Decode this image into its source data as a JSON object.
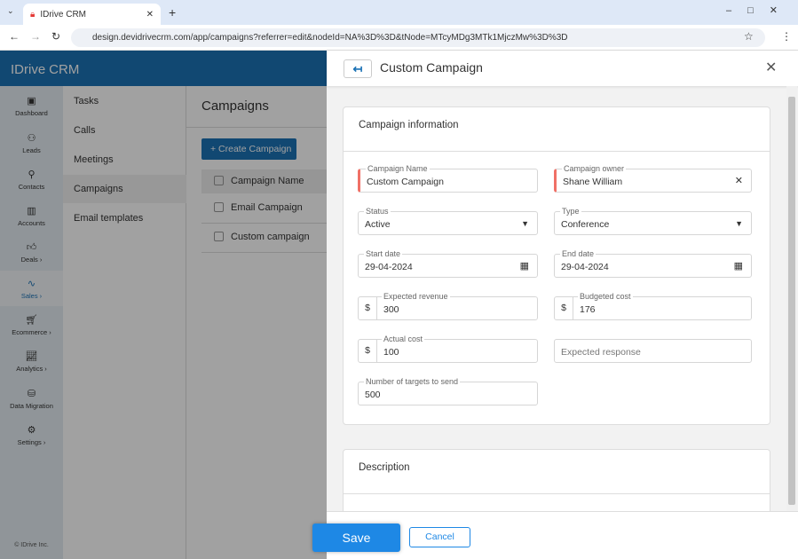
{
  "browser": {
    "tab_title": "IDrive CRM",
    "url": "design.devidrivecrm.com/app/campaigns?referrer=edit&nodeId=NA%3D%3D&tNode=MTcyMDg3MTk1MjczMw%3D%3D"
  },
  "app": {
    "logo": "IDrive",
    "logo_suffix": "CRM",
    "copyright": "© IDrive Inc."
  },
  "rail": [
    {
      "label": "Dashboard",
      "icon": "layout-icon"
    },
    {
      "label": "Leads",
      "icon": "leads-icon"
    },
    {
      "label": "Contacts",
      "icon": "person-icon"
    },
    {
      "label": "Accounts",
      "icon": "building-icon"
    },
    {
      "label": "Deals ›",
      "icon": "thumb-icon"
    },
    {
      "label": "Sales ›",
      "icon": "pulse-icon"
    },
    {
      "label": "Ecommerce ›",
      "icon": "cart-icon"
    },
    {
      "label": "Analytics ›",
      "icon": "chart-icon"
    },
    {
      "label": "Data Migration",
      "icon": "database-icon"
    },
    {
      "label": "Settings ›",
      "icon": "gear-icon"
    }
  ],
  "submenu": [
    "Tasks",
    "Calls",
    "Meetings",
    "Campaigns",
    "Email templates"
  ],
  "main": {
    "title": "Campaigns",
    "create_label": "+ Create Campaign",
    "column": "Campaign Name",
    "rows": [
      "Email Campaign",
      "Custom campaign"
    ]
  },
  "panel": {
    "title": "Custom Campaign",
    "section1": "Campaign information",
    "section2": "Description",
    "fields": {
      "name": {
        "label": "Campaign Name",
        "value": "Custom Campaign"
      },
      "owner": {
        "label": "Campaign owner",
        "value": "Shane William"
      },
      "status": {
        "label": "Status",
        "value": "Active"
      },
      "type": {
        "label": "Type",
        "value": "Conference"
      },
      "start": {
        "label": "Start date",
        "value": "29-04-2024"
      },
      "end": {
        "label": "End date",
        "value": "29-04-2024"
      },
      "revenue": {
        "label": "Expected revenue",
        "value": "300",
        "currency": "$"
      },
      "budget": {
        "label": "Budgeted cost",
        "value": "176",
        "currency": "$"
      },
      "actual": {
        "label": "Actual cost",
        "value": "100",
        "currency": "$"
      },
      "response": {
        "placeholder": "Expected response"
      },
      "targets": {
        "label": "Number of targets to send",
        "value": "500"
      }
    },
    "save": "Save",
    "cancel": "Cancel"
  }
}
